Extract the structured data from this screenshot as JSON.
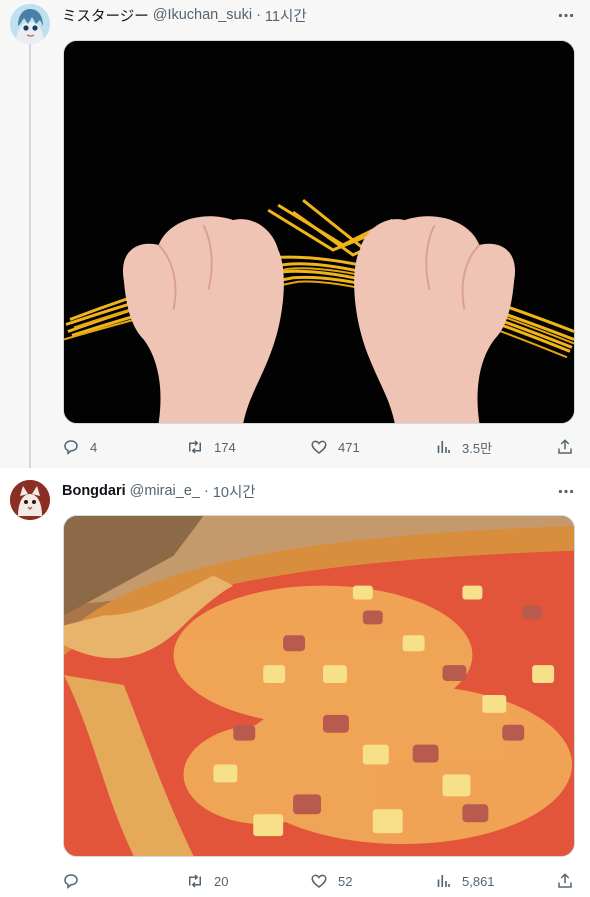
{
  "tweets": [
    {
      "display_name": "ミスタージー",
      "handle": "@Ikuchan_suki",
      "separator": "·",
      "time": "11시간",
      "avatar_icon": "anime-avatar-icon",
      "media_description_icon": "spaghetti-hands-image",
      "stats": {
        "replies": "4",
        "retweets": "174",
        "likes": "471",
        "views": "3.5만"
      }
    },
    {
      "display_name": "Bongdari",
      "handle": "@mirai_e_",
      "separator": "·",
      "time": "10시간",
      "avatar_icon": "cartoon-cat-avatar-icon",
      "media_description_icon": "hawaiian-pizza-image",
      "stats": {
        "replies": "",
        "retweets": "20",
        "likes": "52",
        "views": "5,861"
      }
    }
  ],
  "colors": {
    "text_primary": "#0f1419",
    "text_secondary": "#536471",
    "thread_line": "#cfd9de",
    "tweet1_bg": "#f7f7f7"
  }
}
